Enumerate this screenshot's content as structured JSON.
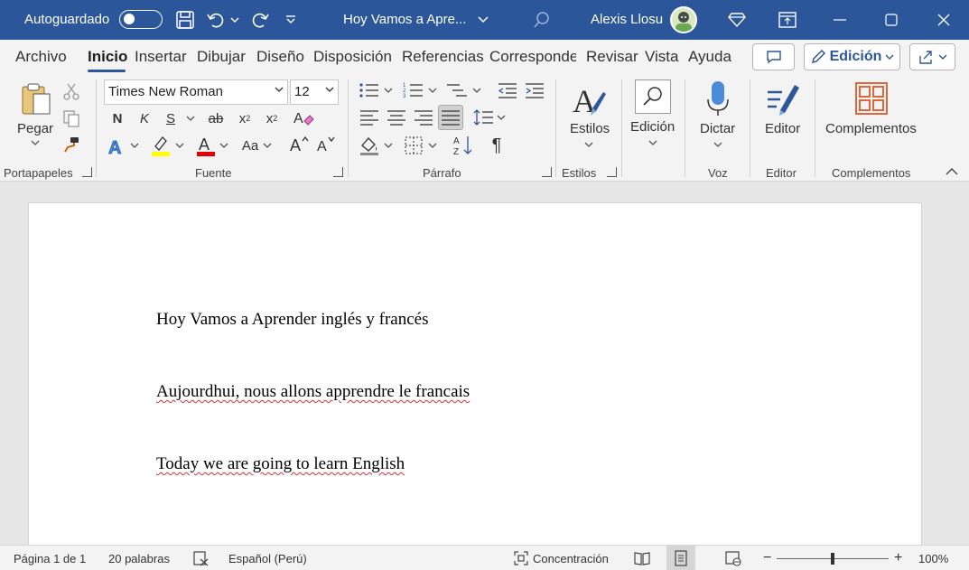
{
  "titlebar": {
    "autosave_label": "Autoguardado",
    "doc_title": "Hoy Vamos a Apre...",
    "user_name": "Alexis Llosu",
    "bg_color": "#2b579a"
  },
  "tabs": [
    {
      "label": "Archivo"
    },
    {
      "label": "Inicio"
    },
    {
      "label": "Insertar"
    },
    {
      "label": "Dibujar"
    },
    {
      "label": "Diseño"
    },
    {
      "label": "Disposición"
    },
    {
      "label": "Referencias"
    },
    {
      "label": "Corresponde"
    },
    {
      "label": "Revisar"
    },
    {
      "label": "Vista"
    },
    {
      "label": "Ayuda"
    }
  ],
  "header_buttons": {
    "editing_mode": "Edición"
  },
  "clipboard": {
    "paste_label": "Pegar",
    "group_label": "Portapapeles"
  },
  "font": {
    "family": "Times New Roman",
    "size": "12",
    "bold": "N",
    "italic": "K",
    "underline": "S",
    "strike": "ab",
    "subscript": "x",
    "superscript": "x",
    "case": "Aa",
    "group_label": "Fuente",
    "highlight_color": "#ffff00",
    "font_color": "#e00000"
  },
  "paragraph": {
    "group_label": "Párrafo",
    "pilcrow": "¶"
  },
  "styles": {
    "label": "Estilos",
    "group_label": "Estilos"
  },
  "editing": {
    "label": "Edición"
  },
  "voice": {
    "label": "Dictar",
    "group_label": "Voz"
  },
  "editor": {
    "label": "Editor",
    "group_label": "Editor"
  },
  "addins": {
    "label": "Complementos",
    "group_label": "Complementos"
  },
  "document": {
    "paragraphs": [
      "Hoy Vamos a Aprender inglés y francés",
      "Aujourdhui, nous allons apprendre le francais",
      "Today we are going to learn English"
    ]
  },
  "statusbar": {
    "page": "Página 1 de 1",
    "words": "20 palabras",
    "language": "Español (Perú)",
    "focus": "Concentración",
    "zoom_minus": "−",
    "zoom_plus": "+",
    "zoom": "100%"
  }
}
